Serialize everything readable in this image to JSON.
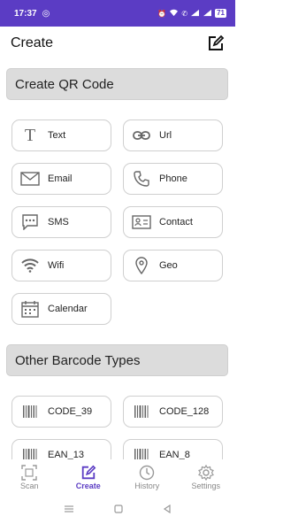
{
  "status_bar": {
    "time": "17:37",
    "battery": "71"
  },
  "app_bar": {
    "title": "Create"
  },
  "sections": {
    "qr": "Create QR Code",
    "barcode": "Other Barcode Types"
  },
  "qr_types": [
    {
      "label": "Text",
      "icon": "text-icon"
    },
    {
      "label": "Url",
      "icon": "link-icon"
    },
    {
      "label": "Email",
      "icon": "email-icon"
    },
    {
      "label": "Phone",
      "icon": "phone-icon"
    },
    {
      "label": "SMS",
      "icon": "sms-icon"
    },
    {
      "label": "Contact",
      "icon": "contact-card-icon"
    },
    {
      "label": "Wifi",
      "icon": "wifi-icon"
    },
    {
      "label": "Geo",
      "icon": "location-pin-icon"
    },
    {
      "label": "Calendar",
      "icon": "calendar-icon"
    }
  ],
  "barcode_types": [
    {
      "label": "CODE_39",
      "icon": "barcode-icon"
    },
    {
      "label": "CODE_128",
      "icon": "barcode-icon"
    },
    {
      "label": "EAN_13",
      "icon": "barcode-icon"
    },
    {
      "label": "EAN_8",
      "icon": "barcode-icon"
    }
  ],
  "bottom_nav": [
    {
      "label": "Scan",
      "icon": "scan-icon"
    },
    {
      "label": "Create",
      "icon": "create-icon",
      "active": true
    },
    {
      "label": "History",
      "icon": "history-icon"
    },
    {
      "label": "Settings",
      "icon": "settings-gear-icon"
    }
  ],
  "colors": {
    "accent": "#5b3cc4",
    "section_bg": "#dcdcdc",
    "icon": "#666666"
  }
}
